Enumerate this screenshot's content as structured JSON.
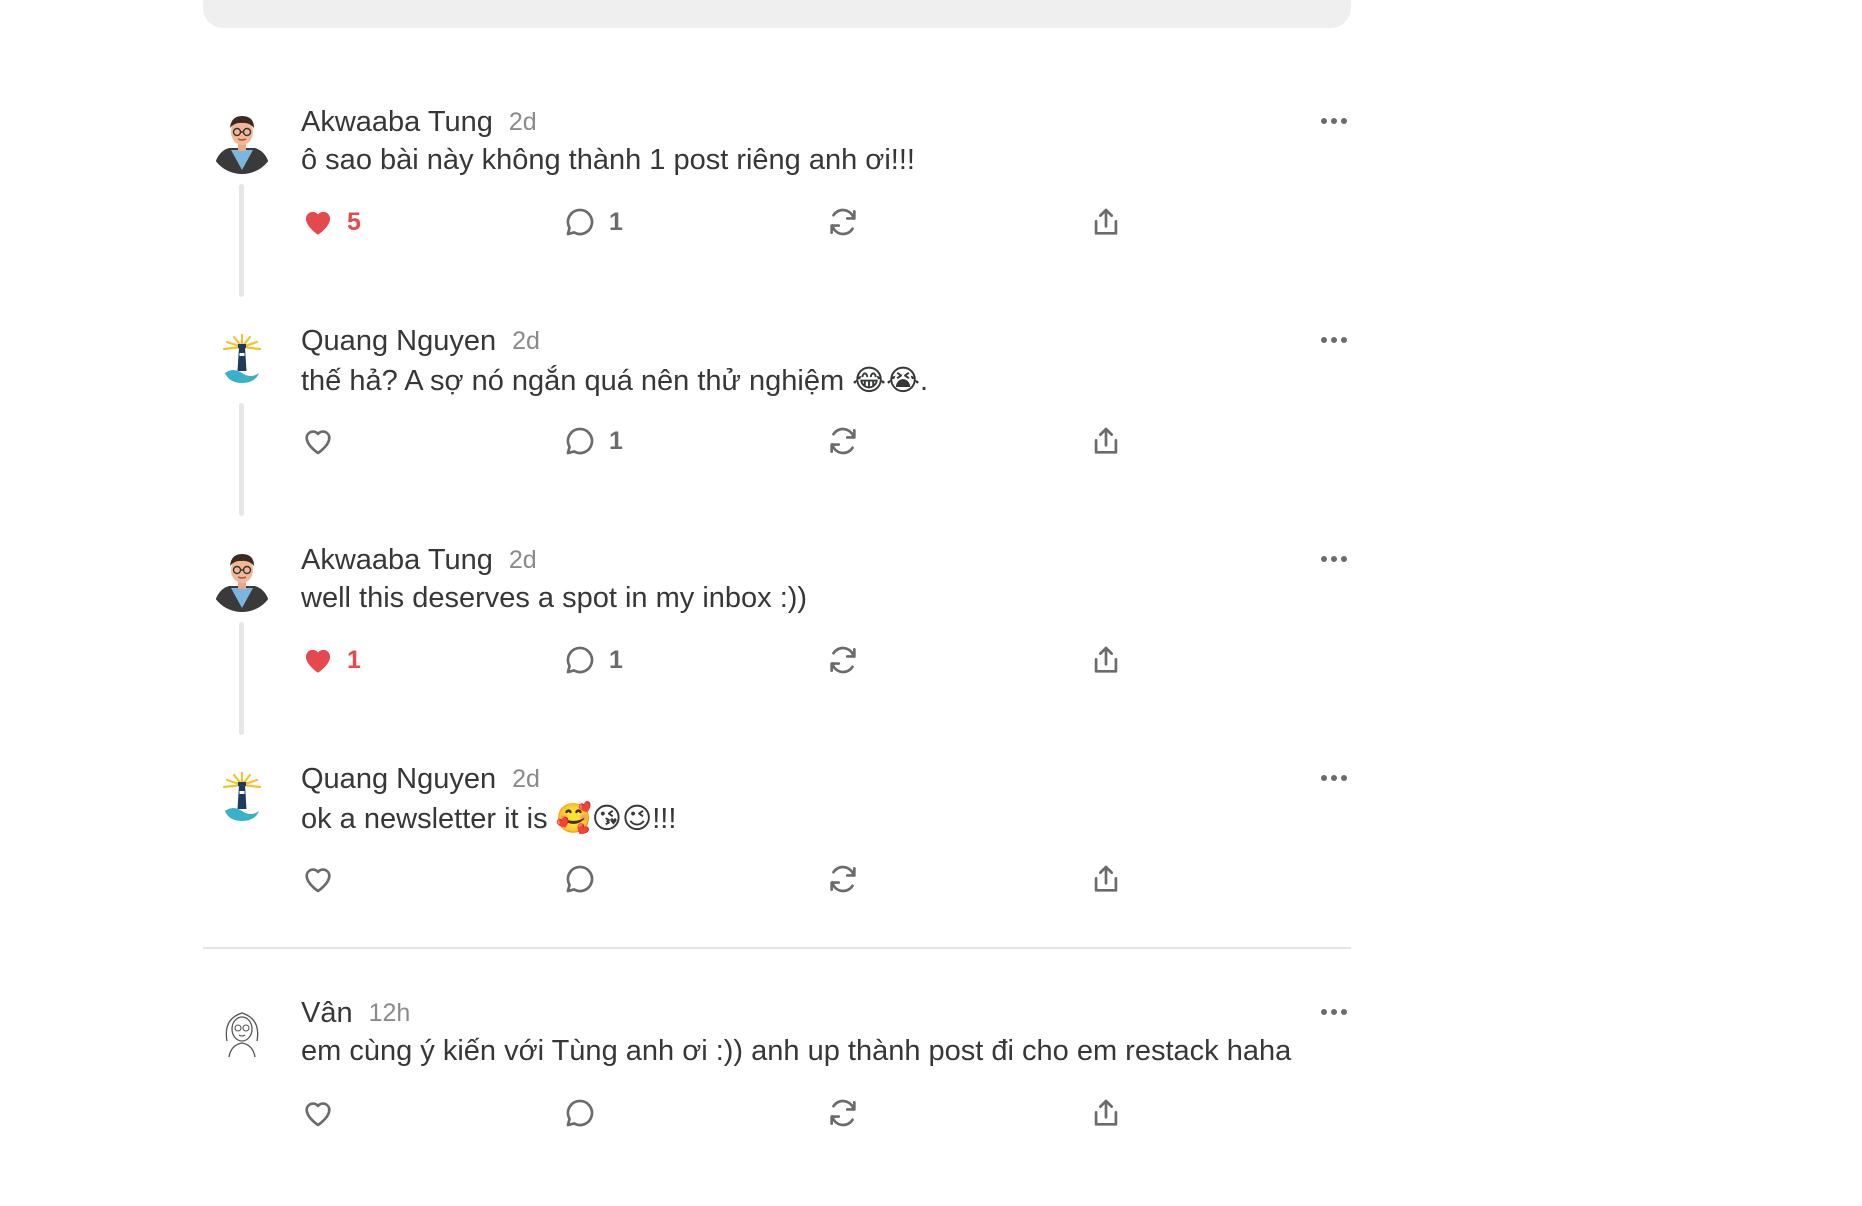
{
  "comments": [
    {
      "author": "Akwaaba Tung",
      "time": "2d",
      "text": "ô sao bài này không thành 1 post riêng anh ơi!!!",
      "likes": "5",
      "liked": true,
      "replies": "1",
      "avatar": "man-avatar"
    },
    {
      "author": "Quang Nguyen",
      "time": "2d",
      "text": "thế hả? A sợ nó ngắn quá nên thử nghiệm 😂😭.",
      "likes": "",
      "liked": false,
      "replies": "1",
      "avatar": "lighthouse-avatar"
    },
    {
      "author": "Akwaaba Tung",
      "time": "2d",
      "text": "well this deserves a spot in my inbox :))",
      "likes": "1",
      "liked": true,
      "replies": "1",
      "avatar": "man-avatar"
    },
    {
      "author": "Quang Nguyen",
      "time": "2d",
      "text": "ok a newsletter it is 🥰😘😉!!!",
      "likes": "",
      "liked": false,
      "replies": "",
      "avatar": "lighthouse-avatar"
    }
  ],
  "separate_comment": {
    "author": "Vân",
    "time": "12h",
    "text": "em cùng ý kiến với Tùng anh ơi :)) anh up thành post đi cho em restack haha",
    "likes": "",
    "liked": false,
    "replies": "",
    "avatar": "sketch-avatar"
  },
  "colors": {
    "like_active": "#e5484d",
    "text": "#363737",
    "muted": "#8a8a8a",
    "icon": "#6b6b6b",
    "thread_line": "#e6e6e6"
  }
}
